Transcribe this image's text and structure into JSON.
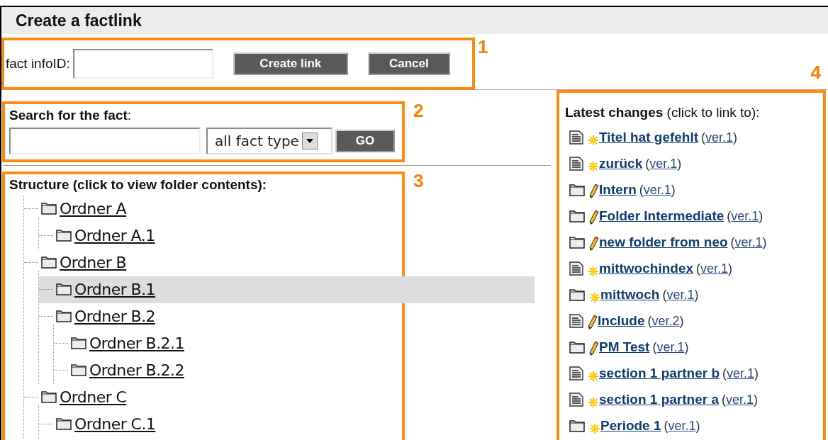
{
  "window": {
    "title": "Create a factlink"
  },
  "callouts": [
    "1",
    "2",
    "3",
    "4"
  ],
  "link_form": {
    "label": "fact infoID:",
    "create_button": "Create link",
    "cancel_button": "Cancel"
  },
  "search": {
    "heading": "**Search for the fact**:",
    "type_select": "all fact type",
    "go_button": "GO"
  },
  "structure": {
    "heading": "Structure (click to view folder contents):",
    "tree": [
      {
        "name": "Ordner A",
        "selected": false,
        "children": [
          {
            "name": "Ordner A.1",
            "selected": false
          }
        ]
      },
      {
        "name": "Ordner B",
        "selected": false,
        "children": [
          {
            "name": "Ordner B.1",
            "selected": true
          },
          {
            "name": "Ordner B.2",
            "selected": false,
            "children": [
              {
                "name": "Ordner B.2.1",
                "selected": false
              },
              {
                "name": "Ordner B.2.2",
                "selected": false
              }
            ]
          }
        ]
      },
      {
        "name": "Ordner C",
        "selected": false,
        "children": [
          {
            "name": "Ordner C.1",
            "selected": false
          }
        ]
      }
    ]
  },
  "latest_changes": {
    "heading": "**Latest changes** (click to link to):",
    "items": [
      {
        "kind": "document",
        "new": true,
        "name": "Titel hat gefehlt",
        "version": "(ver.1)"
      },
      {
        "kind": "document",
        "new": true,
        "name": "zurück",
        "version": "(ver.1)"
      },
      {
        "kind": "folder",
        "new": false,
        "name": "Intern",
        "version": "(ver.1)"
      },
      {
        "kind": "folder",
        "new": false,
        "name": "Folder Intermediate",
        "version": "(ver.1)"
      },
      {
        "kind": "folder",
        "new": false,
        "name": "new folder from neo",
        "version": "(ver.1)"
      },
      {
        "kind": "document",
        "new": true,
        "name": "mittwochindex",
        "version": "(ver.1)"
      },
      {
        "kind": "folder",
        "new": true,
        "name": "mittwoch",
        "version": "(ver.1)"
      },
      {
        "kind": "document",
        "new": false,
        "name": "Include",
        "version": "(ver.2)"
      },
      {
        "kind": "folder",
        "new": false,
        "name": "PM Test",
        "version": "(ver.1)"
      },
      {
        "kind": "document",
        "new": true,
        "name": "section 1 partner b",
        "version": "(ver.1)"
      },
      {
        "kind": "document",
        "new": true,
        "name": "section 1 partner a",
        "version": "(ver.1)"
      },
      {
        "kind": "folder",
        "new": true,
        "name": "Periode 1",
        "version": "(ver.1)"
      }
    ]
  }
}
